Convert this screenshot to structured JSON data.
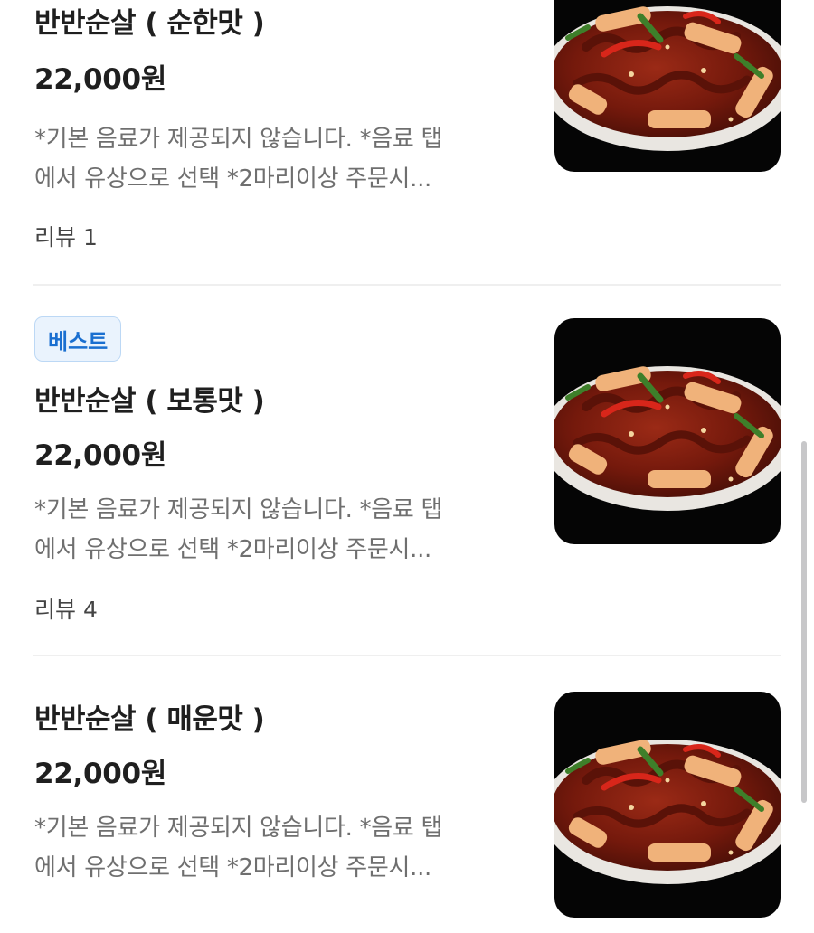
{
  "menu": {
    "items": [
      {
        "badge": "",
        "name": "반반순살 ( 순한맛 )",
        "price": "22,000원",
        "desc_line1": "*기본 음료가 제공되지 않습니다. *음료 탭",
        "desc_line2": "에서 유상으로 선택  *2마리이상 주문시...",
        "review": "리뷰 1",
        "image_icon": "dakgalbi-dish-photo"
      },
      {
        "badge": "베스트",
        "name": "반반순살 ( 보통맛 )",
        "price": "22,000원",
        "desc_line1": "*기본 음료가 제공되지 않습니다. *음료 탭",
        "desc_line2": "에서 유상으로 선택  *2마리이상 주문시...",
        "review": "리뷰 4",
        "image_icon": "dakgalbi-dish-photo"
      },
      {
        "badge": "",
        "name": "반반순살 ( 매운맛 )",
        "price": "22,000원",
        "desc_line1": "*기본 음료가 제공되지 않습니다. *음료 탭",
        "desc_line2": "에서 유상으로 선택  *2마리이상 주문시...",
        "review": "",
        "image_icon": "dakgalbi-dish-photo"
      }
    ]
  },
  "colors": {
    "badge_bg": "#eaf3fd",
    "badge_text": "#1a6fd0",
    "sauce": "#7a1d10",
    "chili": "#d8261a",
    "rice_cake": "#f0b27a",
    "scallion": "#3e7f2a"
  }
}
